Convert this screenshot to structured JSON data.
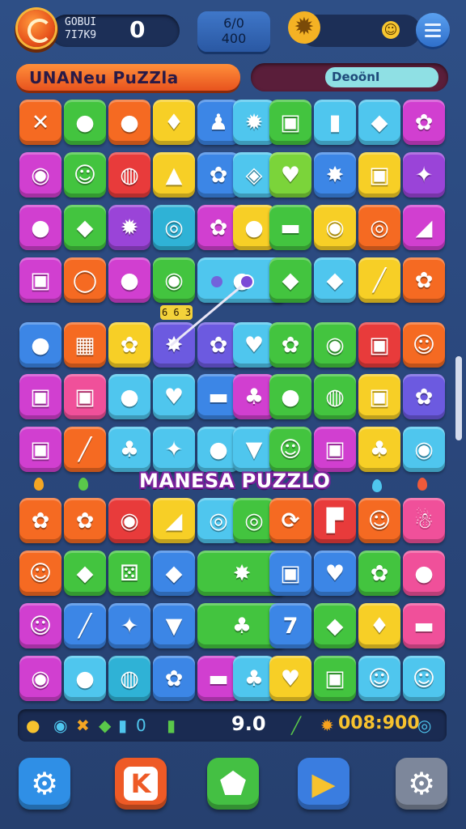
{
  "top_bar": {
    "score_label_line1": "GOBUI",
    "score_label_line2": "7I7K9",
    "score_value": "0",
    "moves_line1": "6/0",
    "moves_line2": "400",
    "gear_icon": "gear-badge-icon",
    "smiley_icon": "smiley-icon",
    "menu_icon": "hamburger-icon"
  },
  "banners": {
    "title": "UNANeu PuZZla",
    "mode": "DeoönI"
  },
  "board": {
    "combo_tag": "6 6 3",
    "center_label": "MANESA PUZZLO",
    "tiles": [
      {
        "row": 0,
        "col": 0,
        "color": "orange",
        "glyph": "✕",
        "name": "tile-cross"
      },
      {
        "row": 0,
        "col": 1,
        "color": "green",
        "glyph": "●",
        "name": "tile-orb"
      },
      {
        "row": 0,
        "col": 2,
        "color": "orange",
        "glyph": "●",
        "name": "tile-orb"
      },
      {
        "row": 0,
        "col": 3,
        "color": "yellow",
        "glyph": "♦",
        "name": "tile-lollipop"
      },
      {
        "row": 0,
        "col": 4,
        "color": "blue",
        "glyph": "♟",
        "name": "tile-pawn"
      },
      {
        "row": 0,
        "col": 5,
        "color": "cyan",
        "glyph": "✹",
        "name": "tile-berry"
      },
      {
        "row": 0,
        "col": 6,
        "color": "green",
        "glyph": "▣",
        "name": "tile-box"
      },
      {
        "row": 0,
        "col": 7,
        "color": "cyan",
        "glyph": "▮",
        "name": "tile-block"
      },
      {
        "row": 0,
        "col": 8,
        "color": "cyan",
        "glyph": "◆",
        "name": "tile-gem"
      },
      {
        "row": 0,
        "col": 9,
        "color": "magenta",
        "glyph": "✿",
        "name": "tile-flower"
      },
      {
        "row": 1,
        "col": 0,
        "color": "magenta",
        "glyph": "◉",
        "name": "tile-candy"
      },
      {
        "row": 1,
        "col": 1,
        "color": "green",
        "glyph": "☺",
        "name": "tile-smiley"
      },
      {
        "row": 1,
        "col": 2,
        "color": "red",
        "glyph": "◍",
        "name": "tile-button"
      },
      {
        "row": 1,
        "col": 3,
        "color": "yellow",
        "glyph": "▲",
        "name": "tile-jar"
      },
      {
        "row": 1,
        "col": 4,
        "color": "blue",
        "glyph": "✿",
        "name": "tile-flower"
      },
      {
        "row": 1,
        "col": 5,
        "color": "cyan",
        "glyph": "◈",
        "name": "tile-cube"
      },
      {
        "row": 1,
        "col": 6,
        "color": "lime",
        "glyph": "♥",
        "name": "tile-heart"
      },
      {
        "row": 1,
        "col": 7,
        "color": "blue",
        "glyph": "✸",
        "name": "tile-star"
      },
      {
        "row": 1,
        "col": 8,
        "color": "yellow",
        "glyph": "▣",
        "name": "tile-box"
      },
      {
        "row": 1,
        "col": 9,
        "color": "purple",
        "glyph": "✦",
        "name": "tile-sparkle"
      },
      {
        "row": 2,
        "col": 0,
        "color": "magenta",
        "glyph": "●",
        "name": "tile-orb"
      },
      {
        "row": 2,
        "col": 1,
        "color": "green",
        "glyph": "◆",
        "name": "tile-gem"
      },
      {
        "row": 2,
        "col": 2,
        "color": "purple",
        "glyph": "✹",
        "name": "tile-burst"
      },
      {
        "row": 2,
        "col": 3,
        "color": "teal",
        "glyph": "◎",
        "name": "tile-ring"
      },
      {
        "row": 2,
        "col": 4,
        "color": "magenta",
        "glyph": "✿",
        "name": "tile-flower"
      },
      {
        "row": 2,
        "col": 5,
        "color": "yellow",
        "glyph": "●",
        "name": "tile-apple"
      },
      {
        "row": 2,
        "col": 6,
        "color": "green",
        "glyph": "▬",
        "name": "tile-bar"
      },
      {
        "row": 2,
        "col": 7,
        "color": "yellow",
        "glyph": "◉",
        "name": "tile-balloon"
      },
      {
        "row": 2,
        "col": 8,
        "color": "orange",
        "glyph": "◎",
        "name": "tile-compass"
      },
      {
        "row": 2,
        "col": 9,
        "color": "magenta",
        "glyph": "◢",
        "name": "tile-kite"
      },
      {
        "row": 3,
        "col": 0,
        "color": "magenta",
        "glyph": "▣",
        "name": "tile-cube"
      },
      {
        "row": 3,
        "col": 1,
        "color": "orange",
        "glyph": "◯",
        "name": "tile-ring"
      },
      {
        "row": 3,
        "col": 2,
        "color": "magenta",
        "glyph": "●",
        "name": "tile-orb"
      },
      {
        "row": 3,
        "col": 3,
        "color": "green",
        "glyph": "◉",
        "name": "tile-balloon"
      },
      {
        "row": 3,
        "col": 4,
        "color": "cyan",
        "glyph": "●",
        "name": "tile-orb-pair",
        "wide": true
      },
      {
        "row": 3,
        "col": 6,
        "color": "green",
        "glyph": "◆",
        "name": "tile-gem"
      },
      {
        "row": 3,
        "col": 7,
        "color": "cyan",
        "glyph": "◆",
        "name": "tile-gem"
      },
      {
        "row": 3,
        "col": 8,
        "color": "yellow",
        "glyph": "╱",
        "name": "tile-pencil"
      },
      {
        "row": 3,
        "col": 9,
        "color": "orange",
        "glyph": "✿",
        "name": "tile-gear"
      },
      {
        "row": 4,
        "col": 0,
        "color": "blue",
        "glyph": "●",
        "name": "tile-orb"
      },
      {
        "row": 4,
        "col": 1,
        "color": "orange",
        "glyph": "▦",
        "name": "tile-gift"
      },
      {
        "row": 4,
        "col": 2,
        "color": "yellow",
        "glyph": "✿",
        "name": "tile-cloud"
      },
      {
        "row": 4,
        "col": 3,
        "color": "violet",
        "glyph": "✸",
        "name": "tile-sun"
      },
      {
        "row": 4,
        "col": 4,
        "color": "violet",
        "glyph": "✿",
        "name": "tile-flower"
      },
      {
        "row": 4,
        "col": 5,
        "color": "cyan",
        "glyph": "♥",
        "name": "tile-heart"
      },
      {
        "row": 4,
        "col": 6,
        "color": "green",
        "glyph": "✿",
        "name": "tile-flower"
      },
      {
        "row": 4,
        "col": 7,
        "color": "green",
        "glyph": "◉",
        "name": "tile-balloon"
      },
      {
        "row": 4,
        "col": 8,
        "color": "red",
        "glyph": "▣",
        "name": "tile-box"
      },
      {
        "row": 4,
        "col": 9,
        "color": "orange",
        "glyph": "☺",
        "name": "tile-shield"
      },
      {
        "row": 5,
        "col": 0,
        "color": "magenta",
        "glyph": "▣",
        "name": "tile-cube"
      },
      {
        "row": 5,
        "col": 1,
        "color": "pink",
        "glyph": "▣",
        "name": "tile-cube"
      },
      {
        "row": 5,
        "col": 2,
        "color": "cyan",
        "glyph": "●",
        "name": "tile-apple"
      },
      {
        "row": 5,
        "col": 3,
        "color": "cyan",
        "glyph": "♥",
        "name": "tile-heart"
      },
      {
        "row": 5,
        "col": 4,
        "color": "blue",
        "glyph": "▬",
        "name": "tile-bar"
      },
      {
        "row": 5,
        "col": 5,
        "color": "magenta",
        "glyph": "♣",
        "name": "tile-jar"
      },
      {
        "row": 5,
        "col": 6,
        "color": "green",
        "glyph": "●",
        "name": "tile-apple"
      },
      {
        "row": 5,
        "col": 7,
        "color": "green",
        "glyph": "◍",
        "name": "tile-button"
      },
      {
        "row": 5,
        "col": 8,
        "color": "yellow",
        "glyph": "▣",
        "name": "tile-lock"
      },
      {
        "row": 5,
        "col": 9,
        "color": "violet",
        "glyph": "✿",
        "name": "tile-gear"
      },
      {
        "row": 6,
        "col": 0,
        "color": "magenta",
        "glyph": "▣",
        "name": "tile-cube"
      },
      {
        "row": 6,
        "col": 1,
        "color": "orange",
        "glyph": "╱",
        "name": "tile-pencil"
      },
      {
        "row": 6,
        "col": 2,
        "color": "cyan",
        "glyph": "♣",
        "name": "tile-clover"
      },
      {
        "row": 6,
        "col": 3,
        "color": "cyan",
        "glyph": "✦",
        "name": "tile-star"
      },
      {
        "row": 6,
        "col": 4,
        "color": "cyan",
        "glyph": "●",
        "name": "tile-ball"
      },
      {
        "row": 6,
        "col": 5,
        "color": "cyan",
        "glyph": "▼",
        "name": "tile-icecream"
      },
      {
        "row": 6,
        "col": 6,
        "color": "green",
        "glyph": "☺",
        "name": "tile-smiley"
      },
      {
        "row": 6,
        "col": 7,
        "color": "magenta",
        "glyph": "▣",
        "name": "tile-box"
      },
      {
        "row": 6,
        "col": 8,
        "color": "yellow",
        "glyph": "♣",
        "name": "tile-basket"
      },
      {
        "row": 6,
        "col": 9,
        "color": "cyan",
        "glyph": "◉",
        "name": "tile-ball"
      },
      {
        "row": 7,
        "col": 0,
        "color": "orange",
        "glyph": "✿",
        "name": "tile-gear"
      },
      {
        "row": 7,
        "col": 1,
        "color": "orange",
        "glyph": "✿",
        "name": "tile-gear"
      },
      {
        "row": 7,
        "col": 2,
        "color": "red",
        "glyph": "◉",
        "name": "tile-balloon"
      },
      {
        "row": 7,
        "col": 3,
        "color": "yellow",
        "glyph": "◢",
        "name": "tile-leaf"
      },
      {
        "row": 7,
        "col": 4,
        "color": "cyan",
        "glyph": "◎",
        "name": "tile-ring"
      },
      {
        "row": 7,
        "col": 5,
        "color": "green",
        "glyph": "◎",
        "name": "tile-ring"
      },
      {
        "row": 7,
        "col": 6,
        "color": "orange",
        "glyph": "⟳",
        "name": "tile-swirl"
      },
      {
        "row": 7,
        "col": 7,
        "color": "red",
        "glyph": "▛",
        "name": "tile-flag"
      },
      {
        "row": 7,
        "col": 8,
        "color": "orange",
        "glyph": "☺",
        "name": "tile-smiley"
      },
      {
        "row": 7,
        "col": 9,
        "color": "pink",
        "glyph": "☃",
        "name": "tile-snowman"
      },
      {
        "row": 8,
        "col": 0,
        "color": "orange",
        "glyph": "☺",
        "name": "tile-smiley"
      },
      {
        "row": 8,
        "col": 1,
        "color": "green",
        "glyph": "◆",
        "name": "tile-gem"
      },
      {
        "row": 8,
        "col": 2,
        "color": "green",
        "glyph": "⚄",
        "name": "tile-dice"
      },
      {
        "row": 8,
        "col": 3,
        "color": "blue",
        "glyph": "◆",
        "name": "tile-gem"
      },
      {
        "row": 8,
        "col": 4,
        "color": "green",
        "glyph": "✸",
        "name": "tile-sun",
        "wide": true
      },
      {
        "row": 8,
        "col": 6,
        "color": "blue",
        "glyph": "▣",
        "name": "tile-cube"
      },
      {
        "row": 8,
        "col": 7,
        "color": "blue",
        "glyph": "♥",
        "name": "tile-heart"
      },
      {
        "row": 8,
        "col": 8,
        "color": "green",
        "glyph": "✿",
        "name": "tile-flower"
      },
      {
        "row": 8,
        "col": 9,
        "color": "pink",
        "glyph": "●",
        "name": "tile-apple"
      },
      {
        "row": 9,
        "col": 0,
        "color": "magenta",
        "glyph": "☺",
        "name": "tile-smiley"
      },
      {
        "row": 9,
        "col": 1,
        "color": "blue",
        "glyph": "╱",
        "name": "tile-pencil"
      },
      {
        "row": 9,
        "col": 2,
        "color": "blue",
        "glyph": "✦",
        "name": "tile-star"
      },
      {
        "row": 9,
        "col": 3,
        "color": "blue",
        "glyph": "▼",
        "name": "tile-icecream"
      },
      {
        "row": 9,
        "col": 4,
        "color": "green",
        "glyph": "♣",
        "name": "tile-bush",
        "wide": true
      },
      {
        "row": 9,
        "col": 6,
        "color": "blue",
        "glyph": "7",
        "name": "tile-seven"
      },
      {
        "row": 9,
        "col": 7,
        "color": "green",
        "glyph": "◆",
        "name": "tile-gem"
      },
      {
        "row": 9,
        "col": 8,
        "color": "yellow",
        "glyph": "♦",
        "name": "tile-lollipop"
      },
      {
        "row": 9,
        "col": 9,
        "color": "pink",
        "glyph": "▬",
        "name": "tile-burger"
      },
      {
        "row": 10,
        "col": 0,
        "color": "magenta",
        "glyph": "◉",
        "name": "tile-candy"
      },
      {
        "row": 10,
        "col": 1,
        "color": "cyan",
        "glyph": "●",
        "name": "tile-lemon"
      },
      {
        "row": 10,
        "col": 2,
        "color": "teal",
        "glyph": "◍",
        "name": "tile-spring"
      },
      {
        "row": 10,
        "col": 3,
        "color": "blue",
        "glyph": "✿",
        "name": "tile-gear"
      },
      {
        "row": 10,
        "col": 4,
        "color": "magenta",
        "glyph": "▬",
        "name": "tile-bar"
      },
      {
        "row": 10,
        "col": 5,
        "color": "cyan",
        "glyph": "♣",
        "name": "tile-bush"
      },
      {
        "row": 10,
        "col": 6,
        "color": "yellow",
        "glyph": "♥",
        "name": "tile-heart"
      },
      {
        "row": 10,
        "col": 7,
        "color": "green",
        "glyph": "▣",
        "name": "tile-box"
      },
      {
        "row": 10,
        "col": 8,
        "color": "cyan",
        "glyph": "☺",
        "name": "tile-smiley"
      },
      {
        "row": 10,
        "col": 9,
        "color": "cyan",
        "glyph": "☺",
        "name": "tile-smiley"
      }
    ]
  },
  "status_bar": {
    "mid_score": "9.0",
    "gold_score": "008:900",
    "icons": [
      "coin-icon",
      "orb-icon",
      "cross-icon",
      "gem-icon",
      "gem-icon",
      "zero-icon",
      "bottle-icon",
      "pencil-icon",
      "sun-icon",
      "compass-icon"
    ]
  },
  "bottom_buttons": [
    {
      "name": "settings-button",
      "icon": "gear-icon",
      "color": "#2f8fe6"
    },
    {
      "name": "back-button",
      "icon": "k-icon",
      "color": "#ee5a26"
    },
    {
      "name": "home-button",
      "icon": "home-icon",
      "color": "#44c043"
    },
    {
      "name": "play-button",
      "icon": "play-icon",
      "color": "#3a7de0"
    },
    {
      "name": "options-button",
      "icon": "gear-icon",
      "color": "#7d879b"
    }
  ],
  "colors": {
    "orange": "#f56a22",
    "green": "#43c43f",
    "red": "#e83b3b",
    "yellow": "#f7cf26",
    "blue": "#3c86e6",
    "teal": "#2fb2d6",
    "purple": "#9a44d8",
    "magenta": "#d13fd0",
    "pink": "#f0509a",
    "lime": "#7bd43a",
    "cyan": "#4fc6ee",
    "violet": "#6c5ae0"
  }
}
